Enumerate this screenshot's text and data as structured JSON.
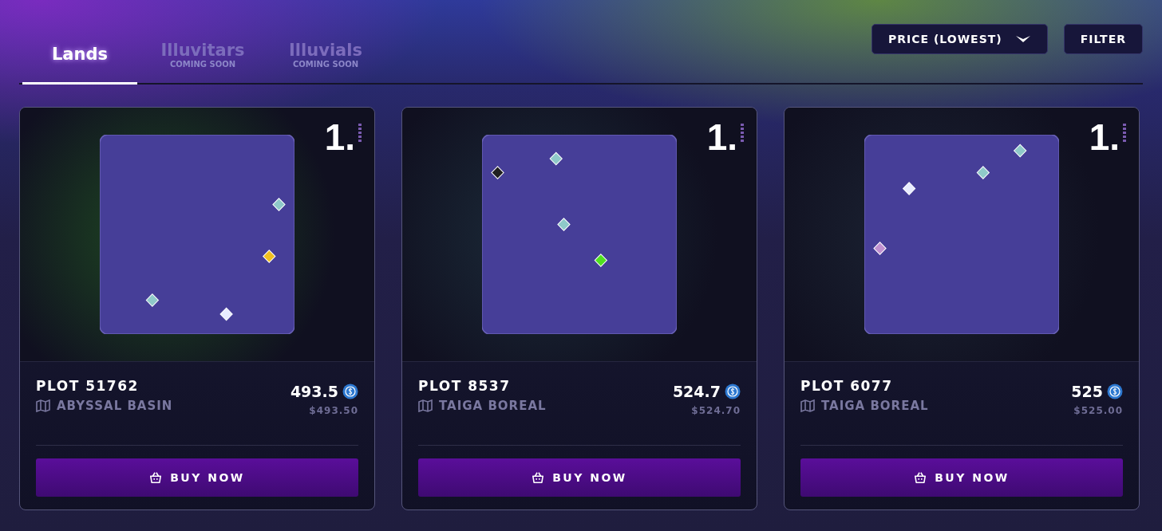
{
  "tabs": [
    {
      "label": "Lands",
      "selected": true
    },
    {
      "label": "Illuvitars",
      "subtitle": "COMING SOON",
      "selected": false
    },
    {
      "label": "Illuvials",
      "subtitle": "COMING SOON",
      "selected": false
    }
  ],
  "sort": {
    "label": "PRICE (LOWEST)"
  },
  "filter_button": "FILTER",
  "cards": [
    {
      "rank": "1.",
      "title": "PLOT 51762",
      "region": "ABYSSAL BASIN",
      "price": "493.5",
      "usd": "$493.50",
      "button": "BUY NOW"
    },
    {
      "rank": "1.",
      "title": "PLOT 8537",
      "region": "TAIGA BOREAL",
      "price": "524.7",
      "usd": "$524.70",
      "button": "BUY NOW"
    },
    {
      "rank": "1.",
      "title": "PLOT 6077",
      "region": "TAIGA BOREAL",
      "price": "525",
      "usd": "$525.00",
      "button": "BUY NOW"
    }
  ]
}
